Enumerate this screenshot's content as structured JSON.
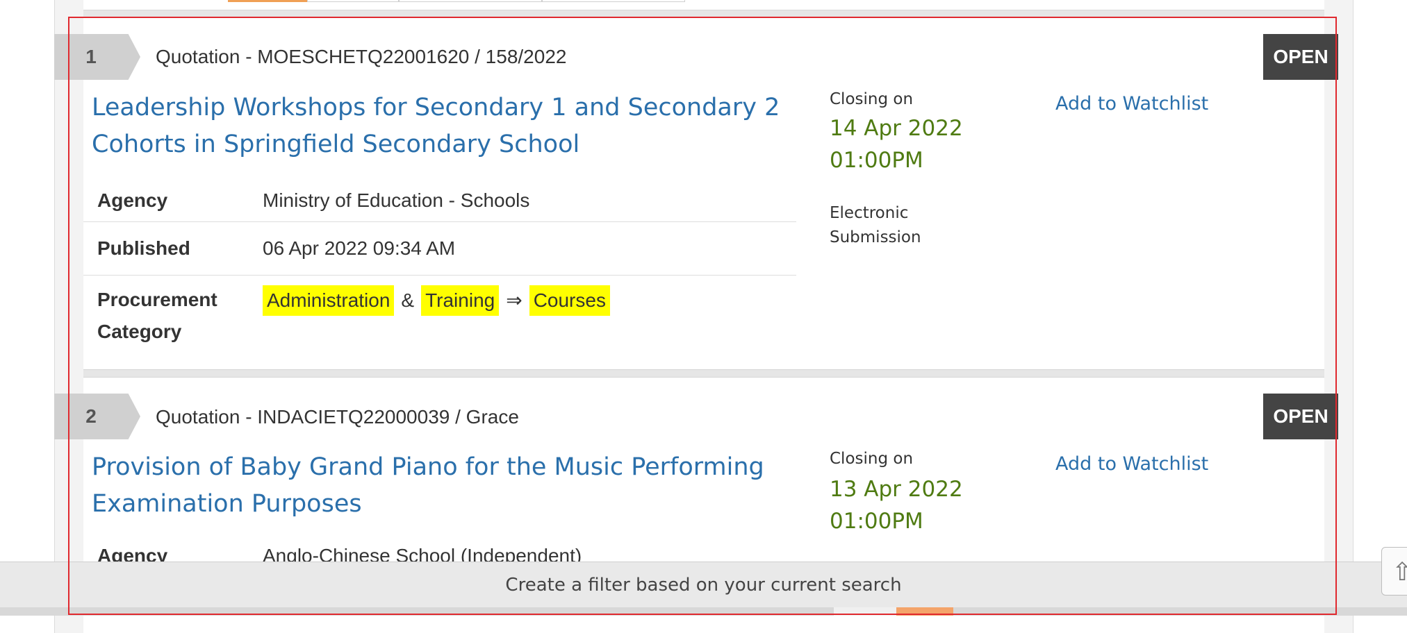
{
  "items": [
    {
      "rank": "1",
      "reference": "Quotation - MOESCHETQ22001620 / 158/2022",
      "status": "OPEN",
      "title_line1": "Leadership Workshops for Secondary 1 and Secondary 2",
      "title_line2": "Cohorts in Springfield Secondary School",
      "closing_label": "Closing on",
      "closing_date": "14 Apr 2022",
      "closing_time": "01:00PM",
      "submission_line1": "Electronic",
      "submission_line2": "Submission",
      "watchlist": "Add to Watchlist",
      "agency_label": "Agency",
      "agency": "Ministry of Education - Schools",
      "published_label": "Published",
      "published": "06 Apr 2022 09:34 AM",
      "category_label_line1": "Procurement",
      "category_label_line2": "Category",
      "category_chips": [
        "Administration",
        "Training",
        "Courses"
      ],
      "category_amp": "&",
      "category_arrow": "⇒"
    },
    {
      "rank": "2",
      "reference": "Quotation - INDACIETQ22000039 / Grace",
      "status": "OPEN",
      "title_line1": "Provision of Baby Grand Piano for the Music Performing",
      "title_line2": "Examination Purposes",
      "closing_label": "Closing on",
      "closing_date": "13 Apr 2022",
      "closing_time": "01:00PM",
      "watchlist": "Add to Watchlist",
      "agency_label": "Agency",
      "agency": "Anglo-Chinese School (Independent)"
    }
  ],
  "filter_bar": {
    "label": "Create a filter based on your current search"
  },
  "icons": {
    "scroll_top": "arrow-up-icon"
  },
  "colors": {
    "link": "#2a6fab",
    "closing": "#4f7b12",
    "status_bg": "#444444",
    "highlight": "#ffff00",
    "frame": "#e0282e"
  }
}
